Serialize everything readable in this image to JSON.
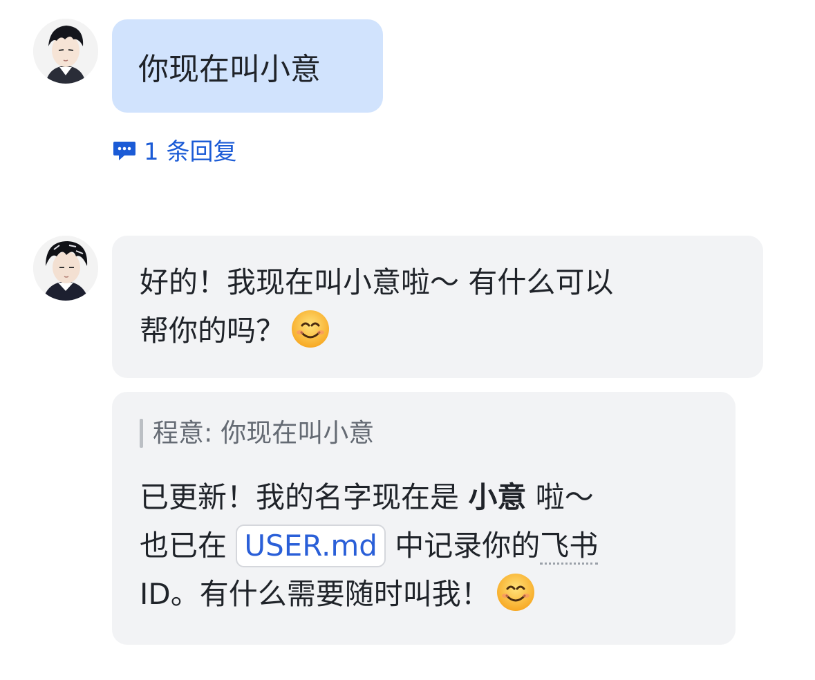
{
  "messages": {
    "user": {
      "text": "你现在叫小意",
      "reply_count_label": "1 条回复"
    },
    "bot_first": {
      "line1": "好的！我现在叫小意啦～ 有什么可以",
      "line2": "帮你的吗？"
    },
    "bot_second": {
      "quote": "程意: 你现在叫小意",
      "text_a": "已更新！我的名字现在是 ",
      "text_bold": "小意",
      "text_b": " 啦～",
      "text_c": "也已在 ",
      "code": "USER.md",
      "text_d": " 中记录你的",
      "text_dotted": "飞书",
      "text_e": "ID。有什么需要随时叫我！"
    }
  },
  "colors": {
    "user_bubble": "#d1e3fd",
    "bot_bubble": "#f2f3f5",
    "link": "#1b5bd6"
  },
  "icons": {
    "reply": "comment-icon",
    "emoji": "smiling-face-icon"
  }
}
